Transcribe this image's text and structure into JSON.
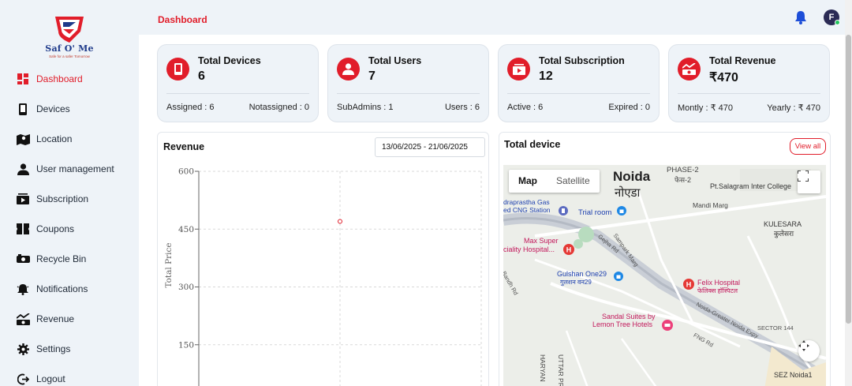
{
  "brand": {
    "name": "Saf O' Me",
    "tagline": "Safe for a safer Tomorrow"
  },
  "header": {
    "title": "Dashboard",
    "avatar_initial": "F"
  },
  "sidebar": {
    "items": [
      {
        "label": "Dashboard",
        "icon": "dashboard-icon",
        "active": true
      },
      {
        "label": "Devices",
        "icon": "device-icon"
      },
      {
        "label": "Location",
        "icon": "map-icon"
      },
      {
        "label": "User management",
        "icon": "user-icon"
      },
      {
        "label": "Subscription",
        "icon": "subscription-icon"
      },
      {
        "label": "Coupons",
        "icon": "coupon-icon"
      },
      {
        "label": "Recycle Bin",
        "icon": "recycle-bin-icon"
      },
      {
        "label": "Notifications",
        "icon": "notification-bell-icon"
      },
      {
        "label": "Revenue",
        "icon": "revenue-icon"
      },
      {
        "label": "Settings",
        "icon": "gear-icon"
      },
      {
        "label": "Logout",
        "icon": "logout-icon"
      }
    ]
  },
  "cards": [
    {
      "title": "Total Devices",
      "value": "6",
      "left": "Assigned : 6",
      "right": "Notassigned : 0",
      "icon": "device-icon"
    },
    {
      "title": "Total Users",
      "value": "7",
      "left": "SubAdmins : 1",
      "right": "Users : 6",
      "icon": "user-icon"
    },
    {
      "title": "Total Subscription",
      "value": "12",
      "left": "Active : 6",
      "right": "Expired : 0",
      "icon": "subscription-icon"
    },
    {
      "title": "Total Revenue",
      "value": "₹470",
      "left": "Montly : ₹ 470",
      "right": "Yearly : ₹ 470",
      "icon": "revenue-icon"
    }
  ],
  "revenue": {
    "title": "Revenue",
    "date_range": "13/06/2025 - 21/06/2025"
  },
  "chart_data": {
    "type": "scatter",
    "title": "Revenue",
    "ylabel": "Total Price",
    "xlabel": "",
    "ylim": [
      0,
      600
    ],
    "yticks": [
      "600",
      "450",
      "300",
      "150"
    ],
    "points": [
      {
        "x_index": 1,
        "y": 470
      }
    ],
    "grid": true,
    "color": "#e11d2a"
  },
  "map_panel": {
    "title": "Total device",
    "view_all": "View all",
    "map_types": [
      "Map",
      "Satellite"
    ],
    "labels": [
      {
        "text": "Noida",
        "big": true
      },
      {
        "text": "नोएडा",
        "big": true
      },
      {
        "text": "PHASE-2"
      },
      {
        "text": "फेस-2"
      },
      {
        "text": "Pt.Salagram Inter College"
      },
      {
        "text": "Mandi Marg"
      },
      {
        "text": "draprastha Gas"
      },
      {
        "text": "ed CNG Station"
      },
      {
        "text": "Trial room"
      },
      {
        "text": "KULESARA"
      },
      {
        "text": "कुलेसरा"
      },
      {
        "text": "Max Super"
      },
      {
        "text": "ciality Hospital..."
      },
      {
        "text": "Gulshan One29"
      },
      {
        "text": "गुलशन वन29"
      },
      {
        "text": "Felix Hospital"
      },
      {
        "text": "फेलिक्स हॉस्पिटल"
      },
      {
        "text": "Sandal Suites by"
      },
      {
        "text": "Lemon Tree Hotels"
      },
      {
        "text": "SECTOR 144"
      },
      {
        "text": "Noida-Greater Noida Expy"
      },
      {
        "text": "UTTAR PRADE"
      },
      {
        "text": "HARYAN"
      },
      {
        "text": "SEZ Noida1"
      },
      {
        "text": "Sampark Marg"
      },
      {
        "text": "Gejha Rd"
      },
      {
        "text": "Bandh Rd"
      },
      {
        "text": "FNG Rd"
      }
    ]
  },
  "colors": {
    "accent": "#e11d2a",
    "panel": "#eef3f8"
  }
}
